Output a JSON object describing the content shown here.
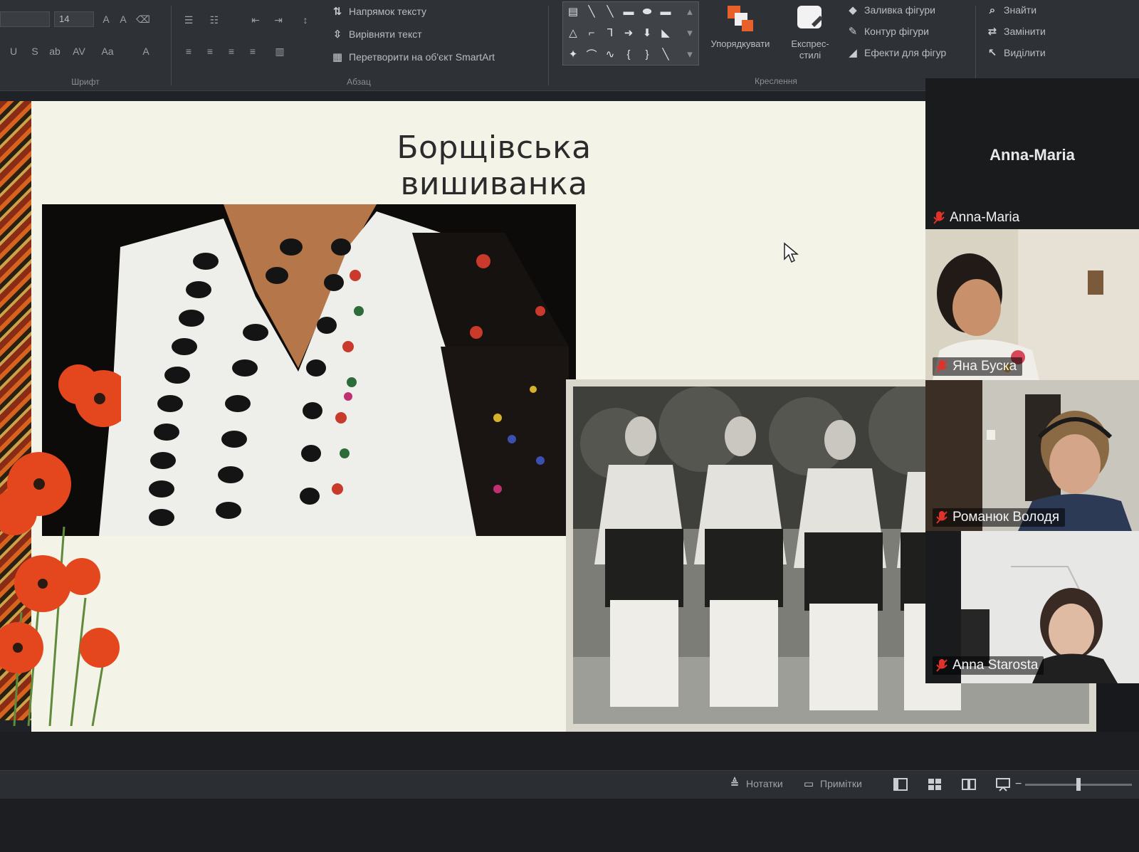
{
  "ribbon": {
    "paragraph": {
      "text_direction_label": "Напрямок тексту",
      "align_text_label": "Вирівняти текст",
      "smartart_label": "Перетворити на об'єкт SmartArt",
      "group_label": "Абзац"
    },
    "font": {
      "size_value": "14",
      "group_label": "Шрифт"
    },
    "drawing": {
      "arrange_label": "Упорядкувати",
      "quick_styles_label": "Експрес-стилі",
      "shape_fill_label": "Заливка фігури",
      "shape_outline_label": "Контур фігури",
      "shape_effects_label": "Ефекти для фігур",
      "group_label": "Креслення"
    },
    "editing": {
      "find_label": "Знайти",
      "replace_label": "Замінити",
      "select_label": "Виділити"
    }
  },
  "slide": {
    "title": "Борщівська вишиванка"
  },
  "participants": {
    "active_speaker": "Anna-Maria",
    "tiles": [
      {
        "name": "Anna-Maria"
      },
      {
        "name": "Яна Буска"
      },
      {
        "name": "Романюк Володя"
      },
      {
        "name": "Anna Starosta"
      }
    ]
  },
  "status_bar": {
    "notes_label": "Нотатки",
    "comments_label": "Примітки"
  },
  "colors": {
    "ribbon_bg": "#2e3236",
    "slide_bg": "#f3f3e7",
    "muted_mic": "#e0322a",
    "poppy": "#e4471e"
  }
}
